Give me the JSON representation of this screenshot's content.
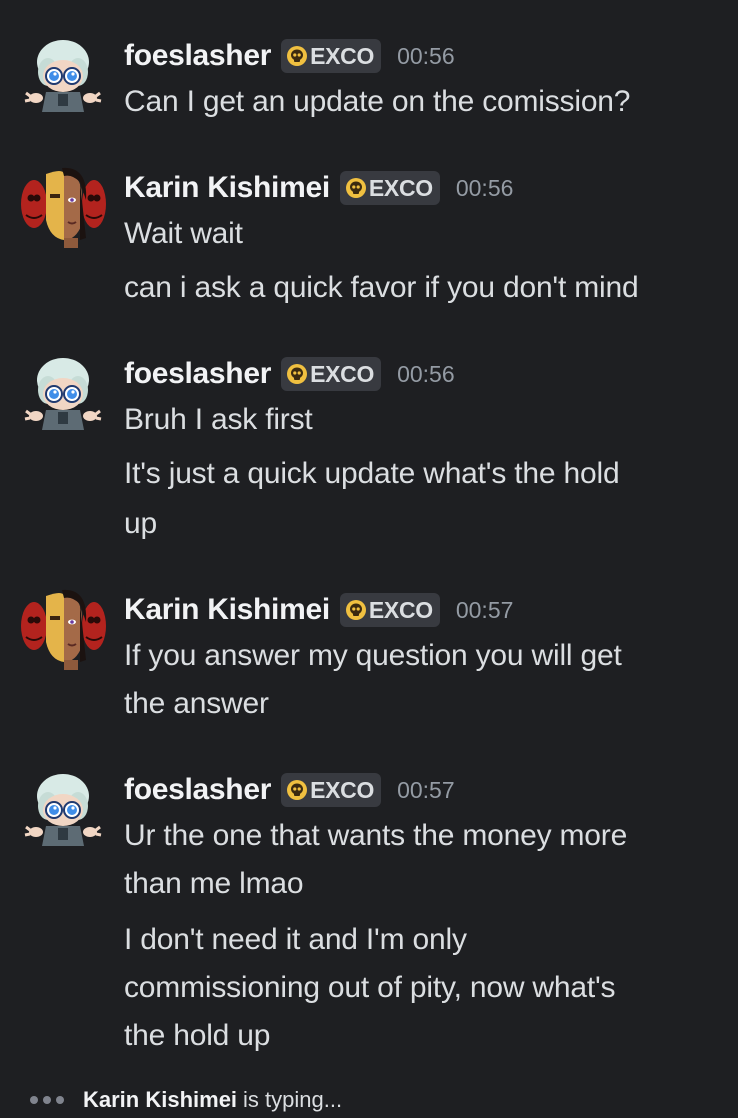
{
  "tag_icon": "skull-icon",
  "colors": {
    "background": "#1e1f22",
    "username": "#f2f3f5",
    "message_text": "#dbdee1",
    "timestamp": "#949ba4",
    "tag_background": "#383a40",
    "tag_icon": "#f0c040"
  },
  "messages": [
    {
      "username": "foeslasher",
      "tag": "EXCO",
      "time": "00:56",
      "lines": [
        "Can I get an update on the comission?"
      ]
    },
    {
      "username": "Karin Kishimei",
      "tag": "EXCO",
      "time": "00:56",
      "lines": [
        "Wait wait",
        "can i ask a quick favor if you don't mind"
      ]
    },
    {
      "username": "foeslasher",
      "tag": "EXCO",
      "time": "00:56",
      "lines": [
        "Bruh I ask first",
        "It's just a quick update what's the hold",
        "up"
      ]
    },
    {
      "username": "Karin Kishimei",
      "tag": "EXCO",
      "time": "00:57",
      "lines": [
        "If you answer my question you will get",
        "the answer"
      ]
    },
    {
      "username": "foeslasher",
      "tag": "EXCO",
      "time": "00:57",
      "lines": [
        "Ur the one that wants the money more",
        "than me lmao",
        "I don't need it and I'm only",
        "commissioning out of pity, now what's",
        "the hold up"
      ]
    }
  ],
  "typing": {
    "name": "Karin Kishimei",
    "suffix": "is typing..."
  }
}
